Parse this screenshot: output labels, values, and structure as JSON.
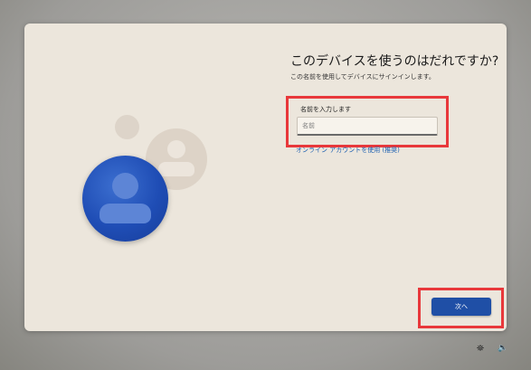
{
  "page": {
    "title": "このデバイスを使うのはだれですか?",
    "subtitle": "この名前を使用してデバイスにサインインします。"
  },
  "name_field": {
    "label": "名前を入力します",
    "placeholder": "名前"
  },
  "online_account_link": "オンライン アカウントを使用 (推奨)",
  "next_button": "次へ",
  "tray": {
    "accessibility_icon": "⛯",
    "volume_icon": "🔈"
  },
  "colors": {
    "accent": "#1f4fa6",
    "highlight": "#e8383b",
    "link": "#1b5fb0"
  }
}
